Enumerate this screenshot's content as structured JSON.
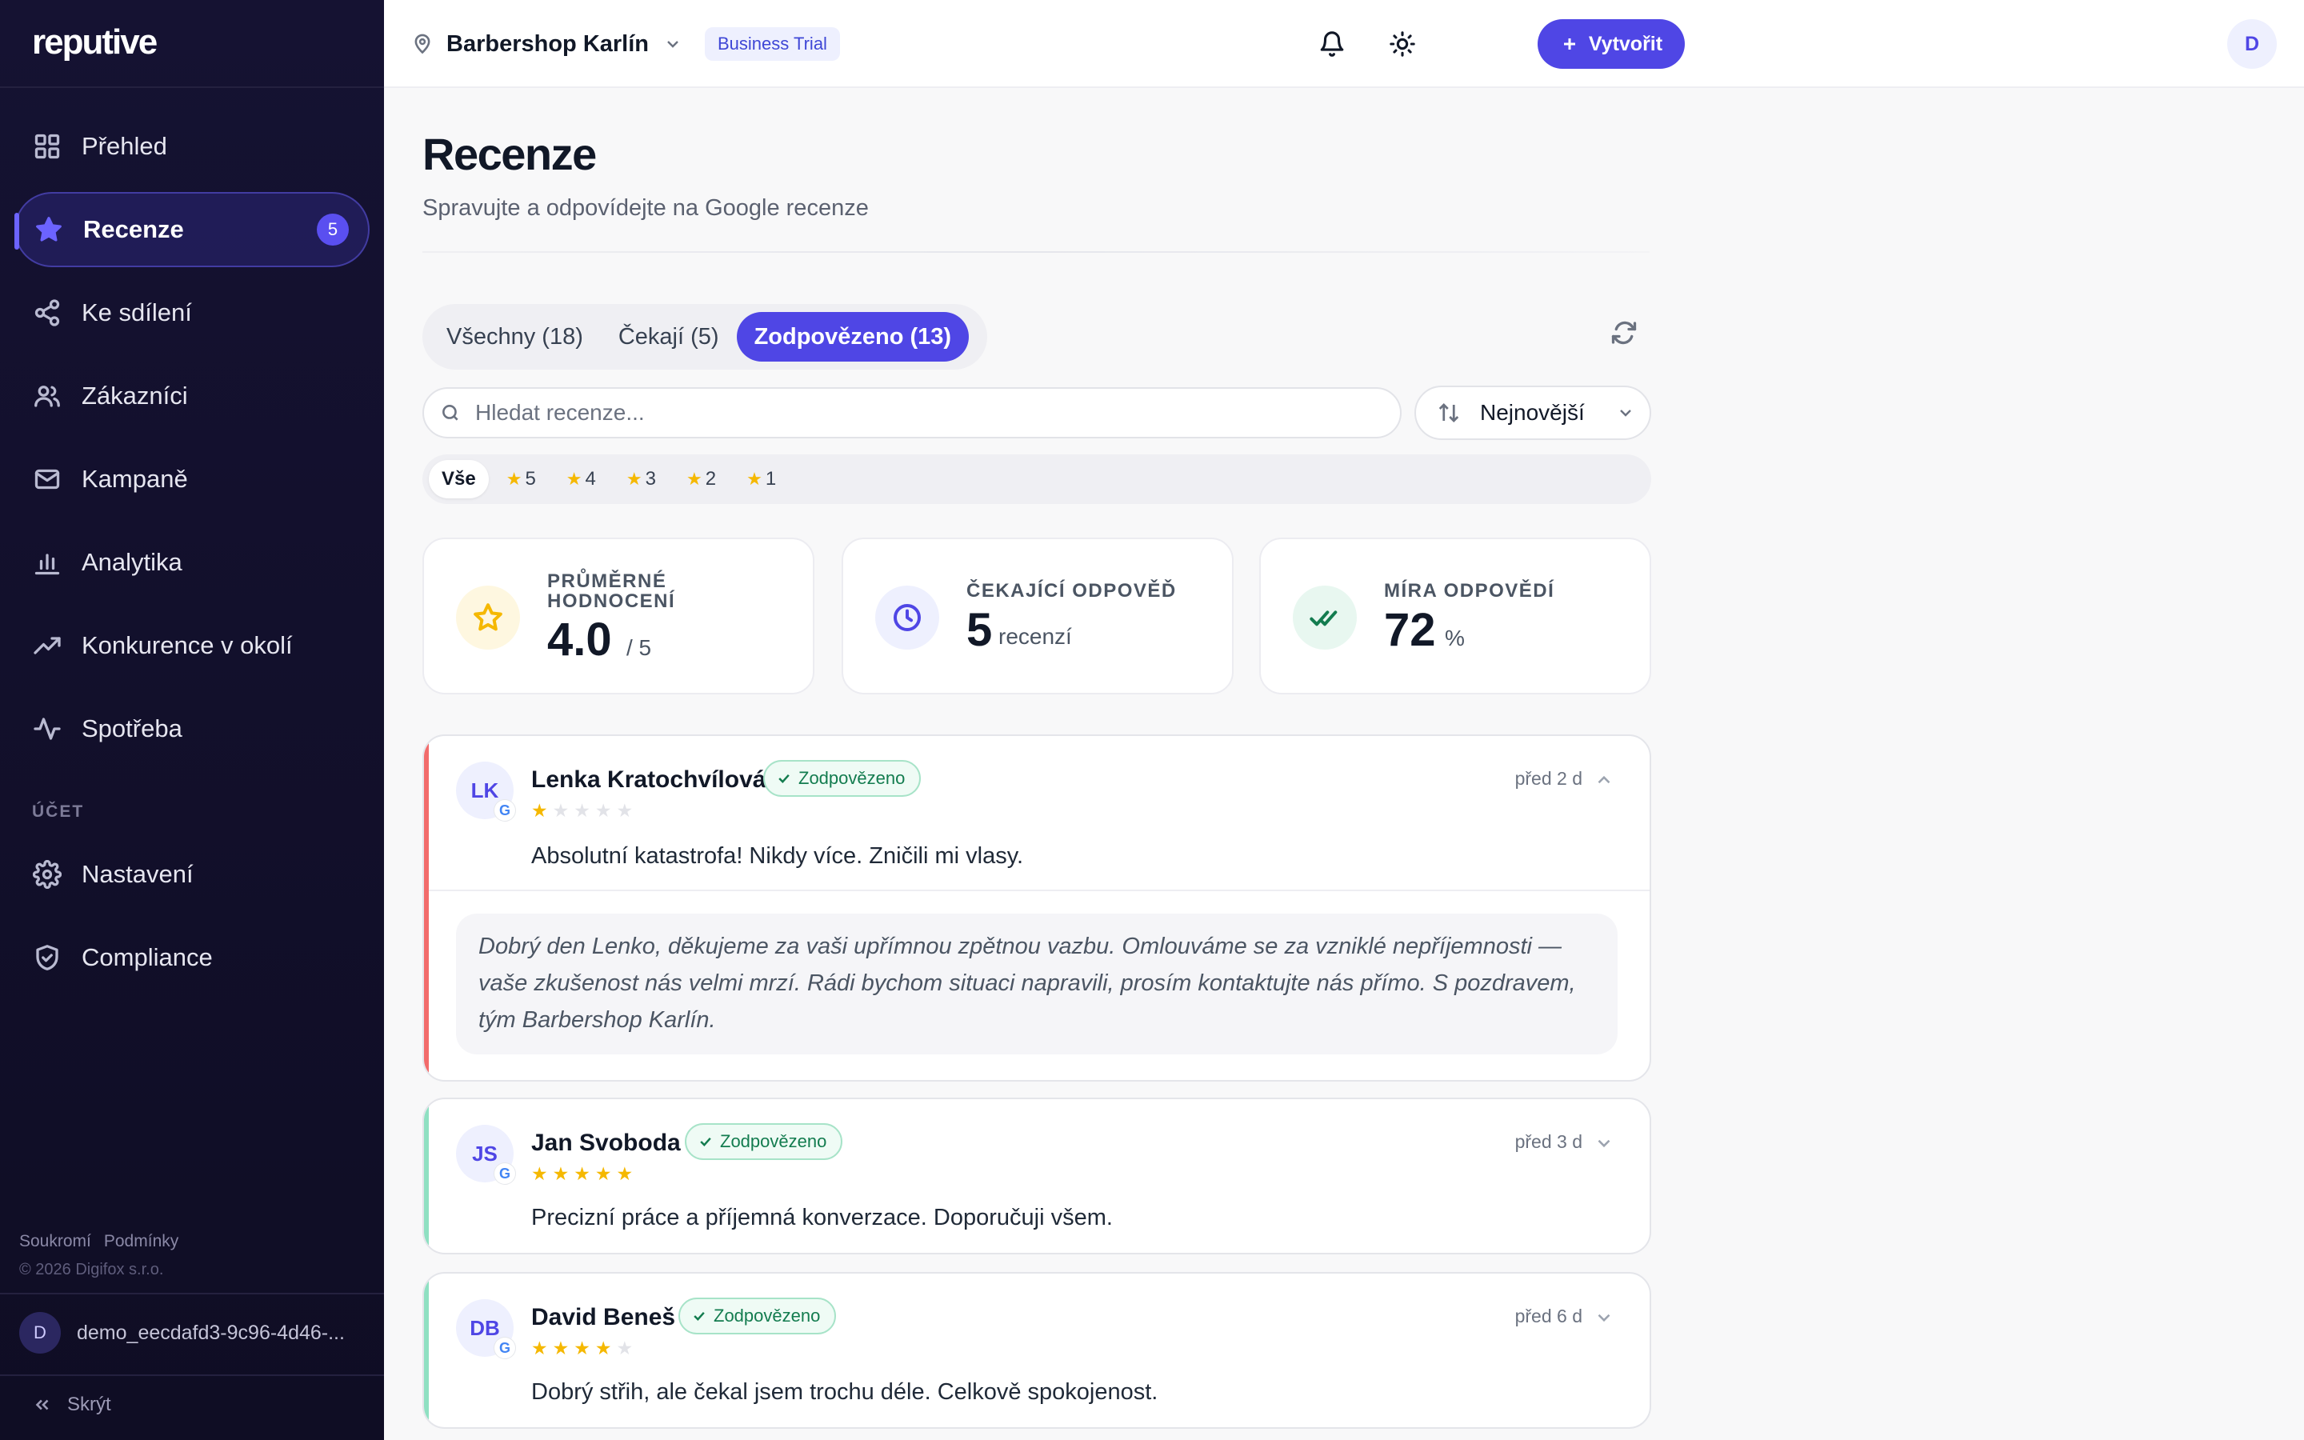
{
  "app": {
    "logo": "reputive"
  },
  "sidebar": {
    "items": [
      {
        "label": "Přehled",
        "icon": "grid-icon"
      },
      {
        "label": "Recenze",
        "icon": "star-icon",
        "badge": "5",
        "active": true
      },
      {
        "label": "Ke sdílení",
        "icon": "share-icon"
      },
      {
        "label": "Zákazníci",
        "icon": "users-icon"
      },
      {
        "label": "Kampaně",
        "icon": "mail-icon"
      },
      {
        "label": "Analytika",
        "icon": "bar-chart-icon"
      },
      {
        "label": "Konkurence v okolí",
        "icon": "trending-up-icon"
      },
      {
        "label": "Spotřeba",
        "icon": "activity-icon"
      }
    ],
    "account_section_label": "ÚČET",
    "account_items": [
      {
        "label": "Nastavení",
        "icon": "gear-icon"
      },
      {
        "label": "Compliance",
        "icon": "shield-check-icon"
      }
    ],
    "footer": {
      "privacy": "Soukromí",
      "terms": "Podmínky",
      "copyright": "© 2026 Digifox s.r.o."
    },
    "user": {
      "initial": "D",
      "name": "demo_eecdafd3-9c96-4d46-..."
    },
    "hide_label": "Skrýt"
  },
  "topbar": {
    "location": "Barbershop Karlín",
    "plan_badge": "Business Trial",
    "create_label": "Vytvořit",
    "avatar_initial": "D"
  },
  "page": {
    "title": "Recenze",
    "subtitle": "Spravujte a odpovídejte na Google recenze"
  },
  "tabs": [
    {
      "label": "Všechny (18)",
      "active": false
    },
    {
      "label": "Čekají (5)",
      "active": false
    },
    {
      "label": "Zodpovězeno (13)",
      "active": true
    }
  ],
  "search": {
    "placeholder": "Hledat recenze...",
    "value": ""
  },
  "sort": {
    "selected": "Nejnovější"
  },
  "star_filters": {
    "all_label": "Vše",
    "ratings": [
      "5",
      "4",
      "3",
      "2",
      "1"
    ]
  },
  "stats": {
    "average": {
      "label": "PRŮMĚRNÉ HODNOCENÍ",
      "value": "4.0",
      "unit": "/ 5"
    },
    "pending": {
      "label": "ČEKAJÍCÍ ODPOVĚĎ",
      "value": "5",
      "unit": "recenzí"
    },
    "rate": {
      "label": "MÍRA ODPOVĚDÍ",
      "value": "72",
      "unit": "%"
    }
  },
  "reviews": [
    {
      "initials": "LK",
      "name": "Lenka Kratochvílová",
      "status": "Zodpovězeno",
      "rating": 1,
      "time": "před 2 d",
      "text": "Absolutní katastrofa! Nikdy více. Zničili mi vlasy.",
      "reply": "Dobrý den Lenko, děkujeme za vaši upřímnou zpětnou vazbu. Omlouváme se za vzniklé nepříjemnosti — vaše zkušenost nás velmi mrzí. Rádi bychom situaci napravili, prosím kontaktujte nás přímo. S pozdravem, tým Barbershop Karlín.",
      "expanded": true,
      "accent": "#f26b6b"
    },
    {
      "initials": "JS",
      "name": "Jan Svoboda",
      "status": "Zodpovězeno",
      "rating": 5,
      "time": "před 3 d",
      "text": "Precizní práce a příjemná konverzace. Doporučuji všem.",
      "expanded": false,
      "accent": "#8fe0c2"
    },
    {
      "initials": "DB",
      "name": "David Beneš",
      "status": "Zodpovězeno",
      "rating": 4,
      "time": "před 6 d",
      "text": "Dobrý střih, ale čekal jsem trochu déle. Celkově spokojenost.",
      "expanded": false,
      "accent": "#8fe0c2"
    }
  ],
  "colors": {
    "accent": "#4f46e5",
    "sidebar_bg": "#151232",
    "star": "#f5b800",
    "success": "#137c4f"
  }
}
